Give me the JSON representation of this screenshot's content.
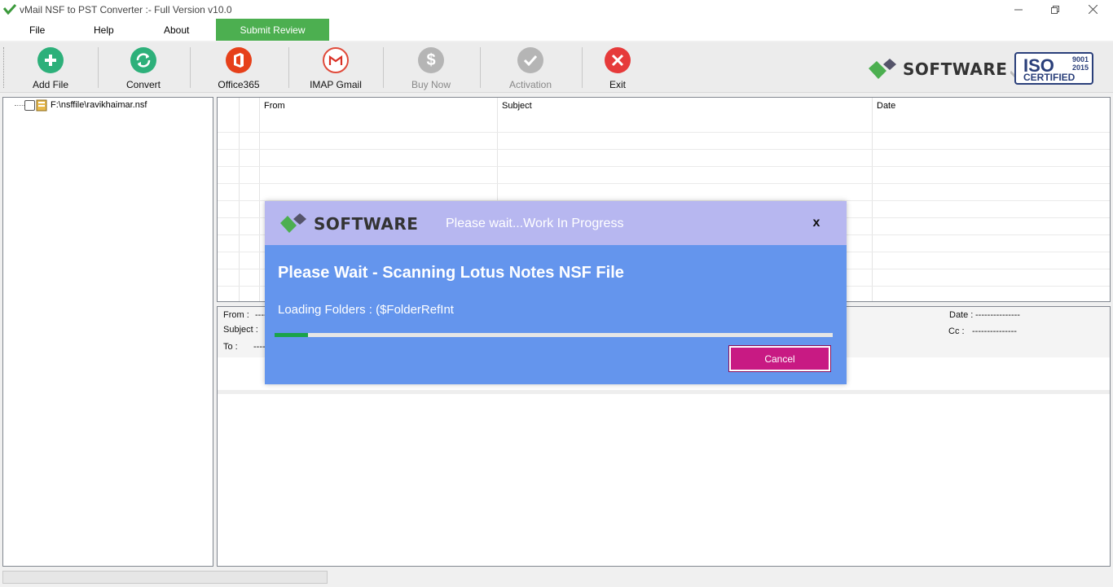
{
  "window": {
    "title": "vMail NSF to PST Converter :- Full Version v10.0"
  },
  "menu": {
    "items": [
      "File",
      "Help",
      "About"
    ],
    "submit_review": "Submit Review"
  },
  "toolbar": {
    "add_file": "Add File",
    "convert": "Convert",
    "office365": "Office365",
    "imap_gmail": "IMAP Gmail",
    "buy_now": "Buy Now",
    "activation": "Activation",
    "exit": "Exit"
  },
  "brand": {
    "name": "SOFTWARE",
    "iso_title": "ISO",
    "iso_years": [
      "9001",
      "2015"
    ],
    "iso_certified": "CERTIFIED"
  },
  "tree": {
    "file_path": "F:\\nsffile\\ravikhaimar.nsf"
  },
  "grid": {
    "columns": [
      "From",
      "Subject",
      "Date"
    ]
  },
  "preview": {
    "from_label": "From :",
    "subject_label": "Subject :",
    "to_label": "To :",
    "date_label": "Date :",
    "cc_label": "Cc :",
    "placeholder_dashes": "---------------"
  },
  "dialog": {
    "logo_text": "SOFTWARE",
    "header_text": "Please wait...Work In Progress",
    "close_glyph": "x",
    "title": "Please Wait - Scanning Lotus Notes NSF File",
    "status": "Loading Folders : ($FolderRefInt",
    "progress_percent": 6,
    "cancel_label": "Cancel"
  },
  "colors": {
    "accent_green": "#4caf50",
    "dialog_blue": "#6495ed",
    "dialog_header": "#b7b7f0",
    "cancel_magenta": "#c81a83",
    "progress_green": "#1aa34a"
  }
}
